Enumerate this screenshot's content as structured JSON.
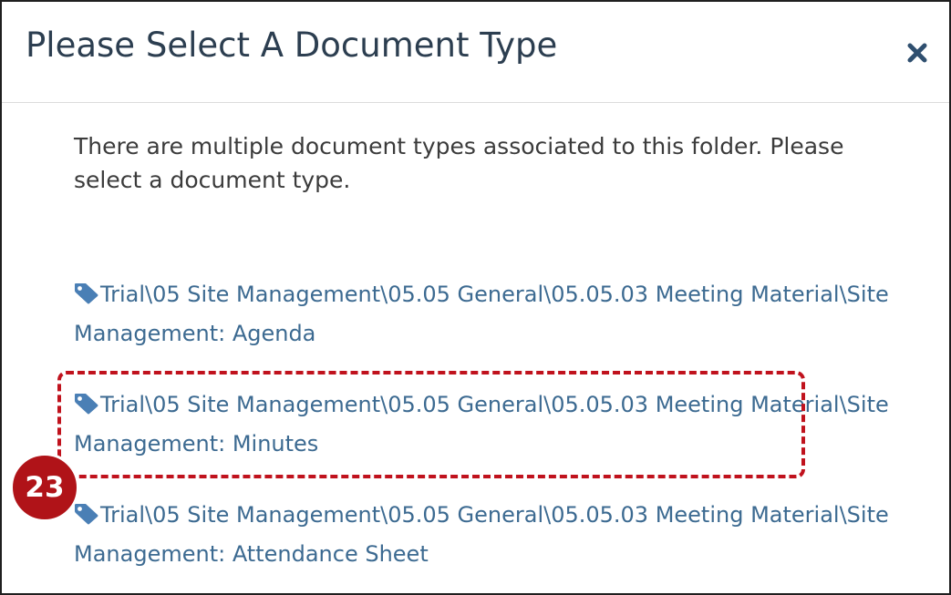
{
  "dialog": {
    "title": "Please Select A Document Type",
    "close_icon": "close-icon",
    "intro_text": "There are multiple document types associated to this folder. Please select a document type."
  },
  "document_types": [
    {
      "icon": "tag-icon",
      "label": "Trial\\05 Site Management\\05.05 General\\05.05.03 Meeting Material\\Site Management: Agenda"
    },
    {
      "icon": "tag-icon",
      "label": "Trial\\05 Site Management\\05.05 General\\05.05.03 Meeting Material\\Site Management: Minutes"
    },
    {
      "icon": "tag-icon",
      "label": "Trial\\05 Site Management\\05.05 General\\05.05.03 Meeting Material\\Site Management: Attendance Sheet"
    }
  ],
  "annotation": {
    "step_number": "23",
    "highlight_color": "#c0121d"
  },
  "colors": {
    "title": "#2c3e50",
    "link": "#3c6a91",
    "icon": "#4a7fb5",
    "close": "#2f4f6f"
  }
}
